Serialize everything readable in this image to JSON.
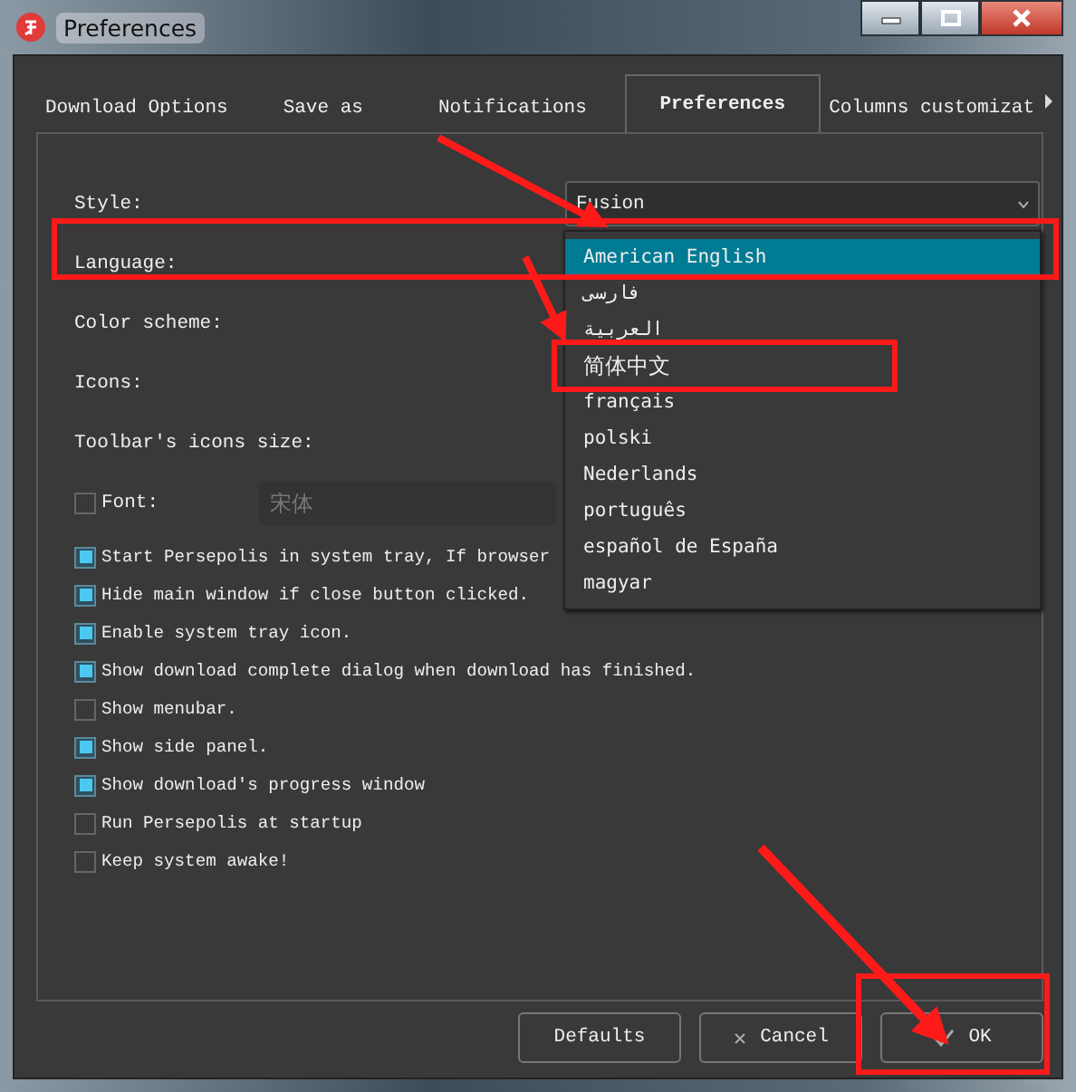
{
  "window": {
    "title": "Preferences"
  },
  "tabs": [
    {
      "label": "Download Options",
      "selected": false
    },
    {
      "label": "Save as",
      "selected": false
    },
    {
      "label": "Notifications",
      "selected": false
    },
    {
      "label": "Preferences",
      "selected": true
    },
    {
      "label": "Columns customizat",
      "selected": false
    }
  ],
  "form": {
    "style": {
      "label": "Style:",
      "value": "Fusion"
    },
    "language": {
      "label": "Language:",
      "options": [
        {
          "label": "American English",
          "selected": true
        },
        {
          "label": "فارسی",
          "selected": false
        },
        {
          "label": "العربية",
          "selected": false
        },
        {
          "label": "简体中文",
          "selected": false
        },
        {
          "label": "français",
          "selected": false
        },
        {
          "label": "polski",
          "selected": false
        },
        {
          "label": "Nederlands",
          "selected": false
        },
        {
          "label": "português",
          "selected": false
        },
        {
          "label": "español de España",
          "selected": false
        },
        {
          "label": "magyar",
          "selected": false
        }
      ]
    },
    "labels": [
      "Color scheme:",
      "Icons:",
      "Toolbar's icons size:"
    ],
    "font": {
      "label": "Font:",
      "checked": false,
      "value": "宋体",
      "disabled": true
    }
  },
  "options": [
    {
      "label": "Start Persepolis in system tray, If browser",
      "checked": true
    },
    {
      "label": "Hide main window if close button clicked.",
      "checked": true
    },
    {
      "label": "Enable system tray icon.",
      "checked": true
    },
    {
      "label": "Show download complete dialog when download has finished.",
      "checked": true
    },
    {
      "label": "Show menubar.",
      "checked": false
    },
    {
      "label": "Show side panel.",
      "checked": true
    },
    {
      "label": "Show download's progress window",
      "checked": true
    },
    {
      "label": "Run Persepolis at startup",
      "checked": false
    },
    {
      "label": "Keep system awake!",
      "checked": false
    }
  ],
  "buttons": [
    {
      "label": "Defaults",
      "kind": "plain"
    },
    {
      "label": "Cancel",
      "kind": "cancel"
    },
    {
      "label": "OK",
      "kind": "ok"
    }
  ]
}
